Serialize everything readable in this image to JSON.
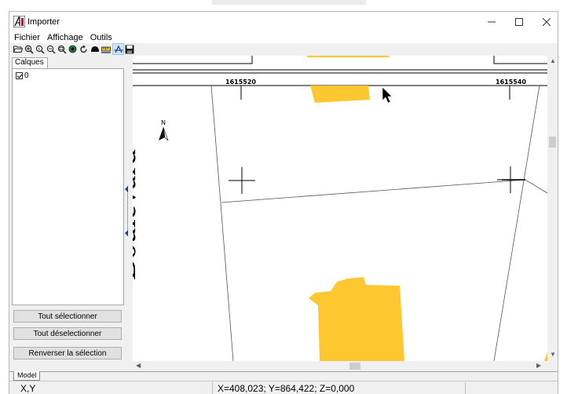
{
  "app": {
    "title": "Importer"
  },
  "menu": {
    "items": [
      "Fichier",
      "Affichage",
      "Outils"
    ]
  },
  "toolbar": {
    "buttons": [
      {
        "icon": "open-folder-icon"
      },
      {
        "icon": "zoom-extents-icon"
      },
      {
        "icon": "zoom-in-icon"
      },
      {
        "icon": "zoom-out-icon"
      },
      {
        "icon": "zoom-window-icon"
      },
      {
        "icon": "zoom-realtime-icon"
      },
      {
        "icon": "regen-icon"
      },
      {
        "icon": "pan-icon"
      },
      {
        "icon": "measure-icon"
      },
      {
        "icon": "select-cursor-icon"
      },
      {
        "icon": "save-icon"
      }
    ]
  },
  "layers_panel": {
    "tab_label": "Calques",
    "layers": [
      {
        "name": "0",
        "checked": true
      }
    ],
    "select_all_label": "Tout sélectionner",
    "deselect_all_label": "Tout déselectionner",
    "invert_selection_label": "Renverser la sélection"
  },
  "drawing": {
    "tick_label_1": "1615520",
    "tick_label_2": "1615540",
    "street_text": "Boulevard",
    "north_label": "N",
    "building_color": "#fdc82f"
  },
  "tabs": {
    "model_label": "Model"
  },
  "status": {
    "label": "X,Y",
    "coords": "X=408,023; Y=864,422; Z=0,000"
  }
}
